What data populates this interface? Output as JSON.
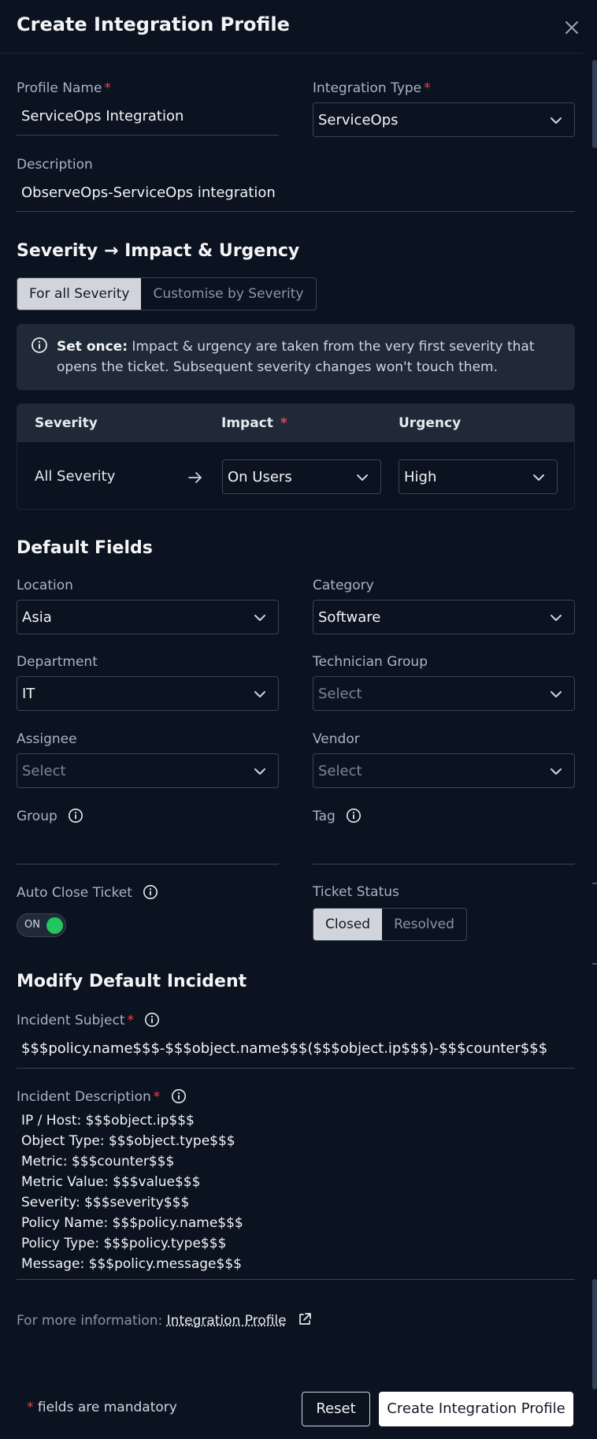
{
  "dialog": {
    "title": "Create Integration Profile"
  },
  "profile": {
    "name_label": "Profile Name",
    "name_value": "ServiceOps Integration",
    "type_label": "Integration Type",
    "type_value": "ServiceOps",
    "description_label": "Description",
    "description_value": "ObserveOps-ServiceOps integration",
    "required_mark": "*"
  },
  "severity_section": {
    "title_part1": "Severity",
    "title_arrow": "→",
    "title_part2": "Impact & Urgency",
    "mode_options": [
      "For all Severity",
      "Customise by Severity"
    ],
    "selected_mode": "For all Severity",
    "info_bold": "Set once:",
    "info_text": " Impact & urgency are taken from the very first severity that opens the ticket. Subsequent severity changes won't touch them.",
    "table_headers": {
      "severity": "Severity",
      "impact": "Impact",
      "urgency": "Urgency"
    },
    "row": {
      "severity": "All Severity",
      "impact": "On Users",
      "urgency": "High"
    }
  },
  "default_fields": {
    "title": "Default Fields",
    "location_label": "Location",
    "location_value": "Asia",
    "category_label": "Category",
    "category_value": "Software",
    "department_label": "Department",
    "department_value": "IT",
    "technician_group_label": "Technician Group",
    "technician_group_value": "Select",
    "assignee_label": "Assignee",
    "assignee_value": "Select",
    "vendor_label": "Vendor",
    "vendor_value": "Select",
    "group_label": "Group",
    "tag_label": "Tag",
    "auto_close_label": "Auto Close Ticket",
    "auto_close_state": "ON",
    "ticket_status_label": "Ticket Status",
    "ticket_status_options": [
      "Closed",
      "Resolved"
    ],
    "ticket_status_selected": "Closed"
  },
  "incident": {
    "title": "Modify Default Incident",
    "subject_label": "Incident Subject",
    "subject_value": "$$$policy.name$$$-$$$object.name$$$($$$object.ip$$$)-$$$counter$$$",
    "description_label": "Incident Description",
    "description_lines": [
      "IP / Host: $$$object.ip$$$",
      "Object Type: $$$object.type$$$",
      "Metric: $$$counter$$$",
      "Metric Value: $$$value$$$",
      "Severity: $$$severity$$$",
      "Policy Name: $$$policy.name$$$",
      "Policy Type: $$$policy.type$$$",
      "Message: $$$policy.message$$$"
    ]
  },
  "more_info": {
    "prefix": "For more information: ",
    "link_text": "Integration Profile"
  },
  "footer": {
    "mandatory_mark": "*",
    "mandatory_note": " fields are mandatory",
    "reset_label": "Reset",
    "create_label": "Create Integration Profile"
  },
  "colors": {
    "background": "#0b1220",
    "required": "#ef4444",
    "toggle_on": "#22c55e",
    "segment_active": "#d1d5db"
  }
}
